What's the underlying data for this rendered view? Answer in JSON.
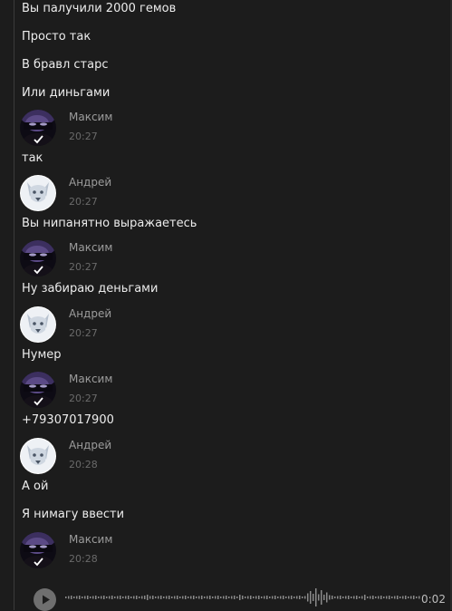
{
  "chat": {
    "messages": [
      {
        "text": "Вы палучили 2000 гемов"
      },
      {
        "text": "Просто так"
      },
      {
        "text": "В бравл старс"
      },
      {
        "text": "Или диньгами"
      },
      {
        "author": "Максим",
        "time": "20:27",
        "avatar": "masked-person-avatar",
        "text": "так"
      },
      {
        "author": "Андрей",
        "time": "20:27",
        "avatar": "dog-avatar",
        "text": "Вы нипанятно выражаетесь"
      },
      {
        "author": "Максим",
        "time": "20:27",
        "avatar": "masked-person-avatar",
        "text": "Ну забираю деньгами"
      },
      {
        "author": "Андрей",
        "time": "20:27",
        "avatar": "dog-avatar",
        "text": "Нумер"
      },
      {
        "author": "Максим",
        "time": "20:27",
        "avatar": "masked-person-avatar",
        "text": "+79307017900"
      },
      {
        "author": "Андрей",
        "time": "20:28",
        "avatar": "dog-avatar",
        "text": "А ой"
      },
      {
        "text": "Я нимагу ввести"
      },
      {
        "author": "Максим",
        "time": "20:28",
        "avatar": "masked-person-avatar"
      }
    ],
    "voice_message": {
      "play_icon": "play-icon",
      "duration": "0:02"
    }
  }
}
